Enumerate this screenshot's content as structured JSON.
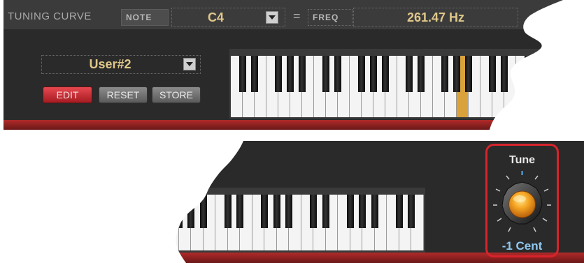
{
  "header": {
    "title": "TUNING CURVE",
    "note_label": "NOTE",
    "note_value": "C4",
    "equals": "=",
    "freq_label": "FREQ",
    "freq_value": "261.47 Hz"
  },
  "preset": {
    "value": "User#2"
  },
  "buttons": {
    "edit": "EDIT",
    "reset": "RESET",
    "store": "STORE"
  },
  "knob": {
    "label": "Tune",
    "value": "-1",
    "unit": "Cent",
    "value_text": "-1  Cent"
  },
  "colors": {
    "panel": "#2a2a2a",
    "accent_text": "#e0c88a",
    "edit_red": "#c7323a",
    "highlight_key": "#d9a23a",
    "knob_orange": "#f0a020",
    "cent_blue": "#8fc8f0",
    "frame_red": "#d8232b"
  },
  "keyboard": {
    "highlighted_key": "C4"
  }
}
